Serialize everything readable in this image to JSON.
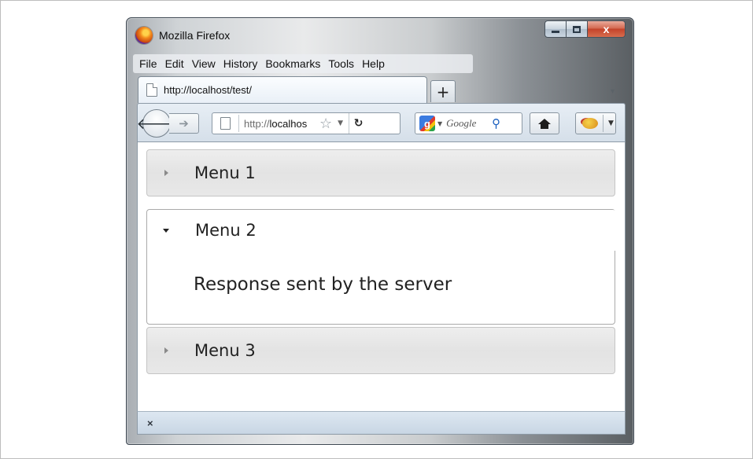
{
  "window": {
    "title": "Mozilla Firefox",
    "close_label": "x"
  },
  "menubar": {
    "items": [
      "File",
      "Edit",
      "View",
      "History",
      "Bookmarks",
      "Tools",
      "Help"
    ]
  },
  "tabs": [
    {
      "label": "http://localhost/test/"
    }
  ],
  "newtab_label": "+",
  "navbar": {
    "url_prefix": "http://",
    "url_host": "localhos",
    "search_placeholder": "Google",
    "search_engine_label": "g"
  },
  "accordion": [
    {
      "label": "Menu 1",
      "expanded": false
    },
    {
      "label": "Menu 2",
      "expanded": true,
      "content": "Response sent by the server"
    },
    {
      "label": "Menu 3",
      "expanded": false
    }
  ],
  "statusbar": {
    "close_label": "×"
  }
}
